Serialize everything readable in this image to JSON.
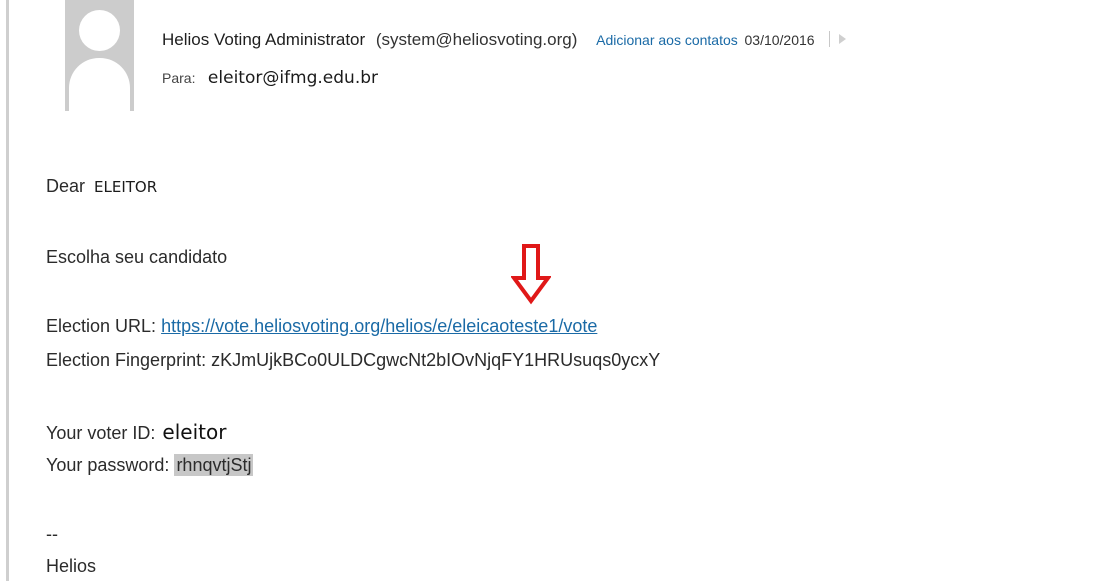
{
  "header": {
    "sender_name": "Helios Voting Administrator",
    "sender_email": "(system@heliosvoting.org)",
    "add_contact": "Adicionar aos contatos",
    "date": "03/10/2016",
    "to_label": "Para:",
    "to_value": "eleitor@ifmg.edu.br"
  },
  "body": {
    "dear": "Dear",
    "dear_name": "ELEITOR",
    "intro": "Escolha seu candidato",
    "election_url_label": "Election URL:",
    "election_url": "https://vote.heliosvoting.org/helios/e/eleicaoteste1/vote",
    "fingerprint_label": "Election Fingerprint:",
    "fingerprint": "zKJmUjkBCo0ULDCgwcNt2bIOvNjqFY1HRUsuqs0ycxY",
    "voter_id_label": "Your voter ID:",
    "voter_id": "eleitor",
    "password_label": "Your password:",
    "password": "rhnqvtjStj",
    "sig_dash": "--",
    "sig_name": "Helios"
  },
  "colors": {
    "link": "#1a6aa6",
    "annotation_arrow": "#e01818",
    "password_highlight": "#c7c7c7"
  },
  "icons": {
    "avatar": "person-placeholder-icon",
    "flag": "flag-icon",
    "arrow": "down-arrow-icon"
  }
}
